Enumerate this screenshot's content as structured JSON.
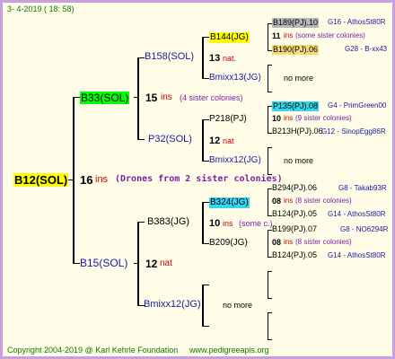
{
  "header": {
    "date": "3-   4-2019  ( 18:  58)"
  },
  "footer": {
    "copyright": "Copyright 2004-2019 @ Karl Kehrle Foundation",
    "site": "www.pedigreeapis.org"
  },
  "root": {
    "name": "B12(SOL)",
    "count": "16",
    "ins": "ins",
    "note": "(Drones from 2 sister colonies)"
  },
  "gen1": [
    {
      "name": "B33(SOL)",
      "count": "15",
      "suffix": "ins",
      "note": "(4 sister colonies)"
    },
    {
      "name": "B15(SOL)",
      "count": "12",
      "suffix": "nat",
      "note": ""
    }
  ],
  "gen2": [
    {
      "name": "B158(SOL)",
      "count": "13",
      "suffix": "nat."
    },
    {
      "name": "P32(SOL)",
      "count": "12",
      "suffix": "nat"
    },
    {
      "name": "B383(JG)",
      "count": "10",
      "suffix": "ins",
      "note": "(some c.)"
    },
    {
      "name": "Bmixx12(JG)",
      "extra": "no more"
    }
  ],
  "gen3": [
    {
      "name": "B144(JG)"
    },
    {
      "name": "Bmixx13(JG)",
      "extra": "no more"
    },
    {
      "name": "P218(PJ)"
    },
    {
      "name": "Bmixx12(JG)",
      "extra": "no more"
    },
    {
      "name": "B324(JG)",
      "count": "08",
      "suffix": "ins",
      "note": "(8 sister colonies)"
    },
    {
      "name": "B209(JG)"
    }
  ],
  "gen4": [
    {
      "name": "B189(PJ).10",
      "mark": "G16 - AthosSt80R"
    },
    {
      "count": "11",
      "suffix": "ins",
      "note": "(some sister colonies)"
    },
    {
      "name": "B190(PJ).06",
      "mark": "G28 - B-xx43"
    },
    {
      "name": "P135(PJ).08",
      "mark": "G4 - PrimGreen00"
    },
    {
      "count": "10",
      "suffix": "ins",
      "note": "(9 sister colonies)"
    },
    {
      "name": "B213H(PJ).06",
      "mark": "G12 - SinopEgg86R"
    },
    {
      "name": "B294(PJ).06",
      "mark": "G8 - Takab93R"
    },
    {
      "name": "B124(PJ).05",
      "mark": "G14 - AthosSt80R"
    },
    {
      "name": "B199(PJ).07",
      "mark": "G8 - NO6294R"
    },
    {
      "count": "08",
      "suffix": "ins",
      "note": "(8 sister colonies)"
    },
    {
      "name": "B124(PJ).05",
      "mark": "G14 - AthosSt80R"
    }
  ]
}
